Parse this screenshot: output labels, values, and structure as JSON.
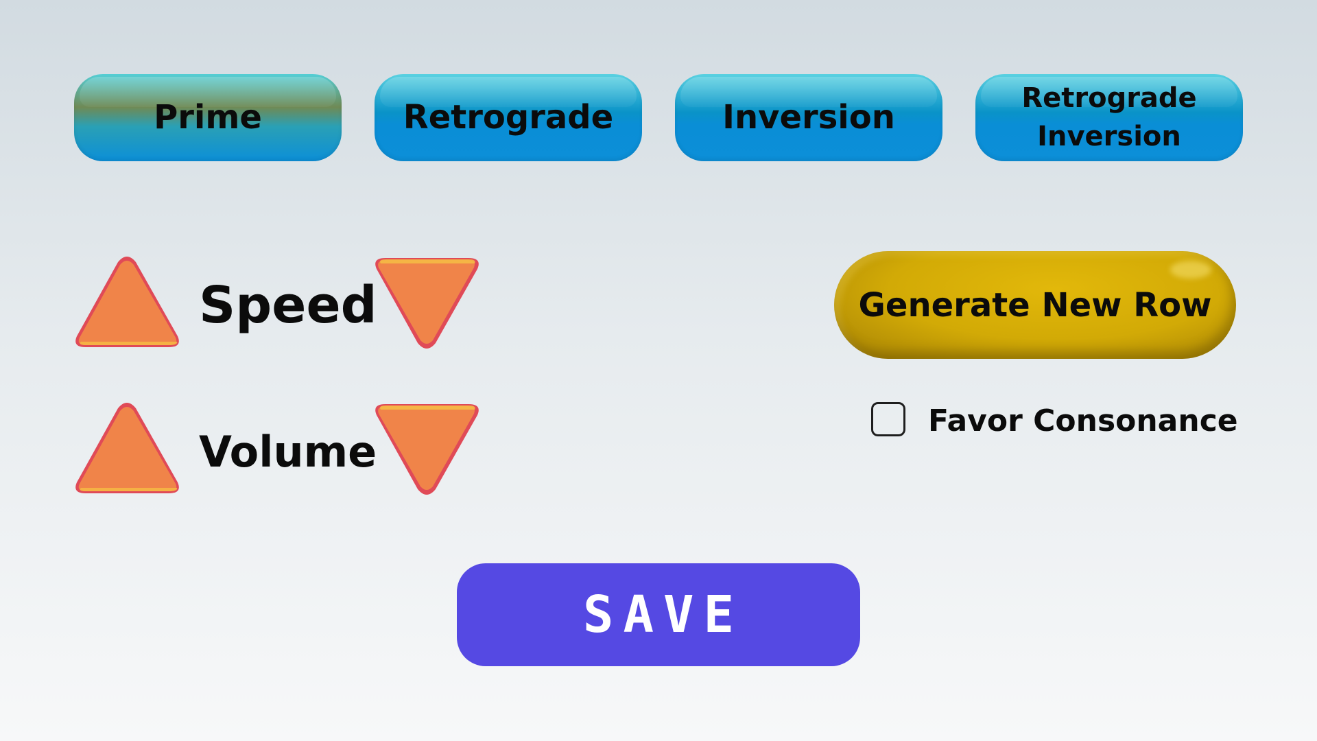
{
  "row_forms": {
    "buttons": [
      {
        "id": "prime",
        "label": "Prime",
        "active": true
      },
      {
        "id": "retrograde",
        "label": "Retrograde",
        "active": false
      },
      {
        "id": "inversion",
        "label": "Inversion",
        "active": false
      },
      {
        "id": "retrograde_inversion",
        "label": "Retrograde\nInversion",
        "active": false
      }
    ]
  },
  "controls": {
    "speed_label": "Speed",
    "volume_label": "Volume",
    "arrow_color": "#f08449",
    "arrow_highlight_color": "#f6bd44",
    "arrow_edge_color": "#e04a57"
  },
  "generate": {
    "label": "Generate New Row",
    "color": "#d2aa06"
  },
  "favor_consonance": {
    "label": "Favor Consonance",
    "checked": false
  },
  "save": {
    "label": "SAVE",
    "color": "#5549e3"
  },
  "colors": {
    "tab_top": "#5bd2e2",
    "tab_bottom": "#0c8fd8",
    "background_top": "#d2dbe1",
    "background_bottom": "#f7f8f9"
  }
}
